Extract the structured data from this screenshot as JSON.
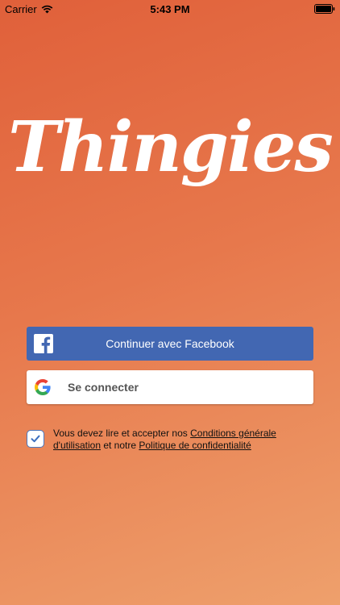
{
  "status_bar": {
    "carrier": "Carrier",
    "time": "5:43 PM"
  },
  "app": {
    "logo_text": "Thingies"
  },
  "auth": {
    "facebook_label": "Continuer avec Facebook",
    "google_label": "Se connecter"
  },
  "terms": {
    "checked": true,
    "text_before": "Vous devez lire et accepter nos ",
    "conditions_link": "Conditions générale d'utilisation",
    "text_middle": " et notre ",
    "privacy_link": "Politique de confidentialité"
  },
  "colors": {
    "background_top": "#e0603a",
    "background_bottom": "#eea06c",
    "facebook_blue": "#4267b2",
    "checkbox_blue": "#4a78c0"
  },
  "icons": [
    "wifi-icon",
    "battery-icon",
    "facebook-icon",
    "google-icon",
    "checkmark-icon"
  ]
}
